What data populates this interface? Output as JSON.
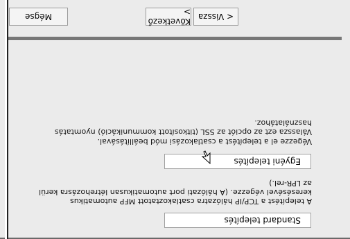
{
  "options": [
    {
      "label": "Standard telepítés",
      "description": "A telepítést a TCP/IP hálózatra csatlakoztatott MFP automatikus keresésével végezze. (A hálózati port automatikusan létrehozásra kerül az LPR-rel.)"
    },
    {
      "label": "Egyéni telepítés",
      "description_lines": [
        "Végezze el a telepítést a csatlakozási mód beállításával.",
        "Válassza ezt az opciót az SSL (titkosított kommunikáció) nyomtatás használatához."
      ]
    }
  ],
  "buttons": {
    "back": "< Vissza",
    "next": "Következő >",
    "cancel": "Mégse"
  },
  "colors": {
    "dialog_bg": "#ebebeb",
    "panel_gray": "#777777",
    "button_bg": "#f4f4f4"
  },
  "icons": {
    "cursor": "mouse-pointer-icon"
  }
}
